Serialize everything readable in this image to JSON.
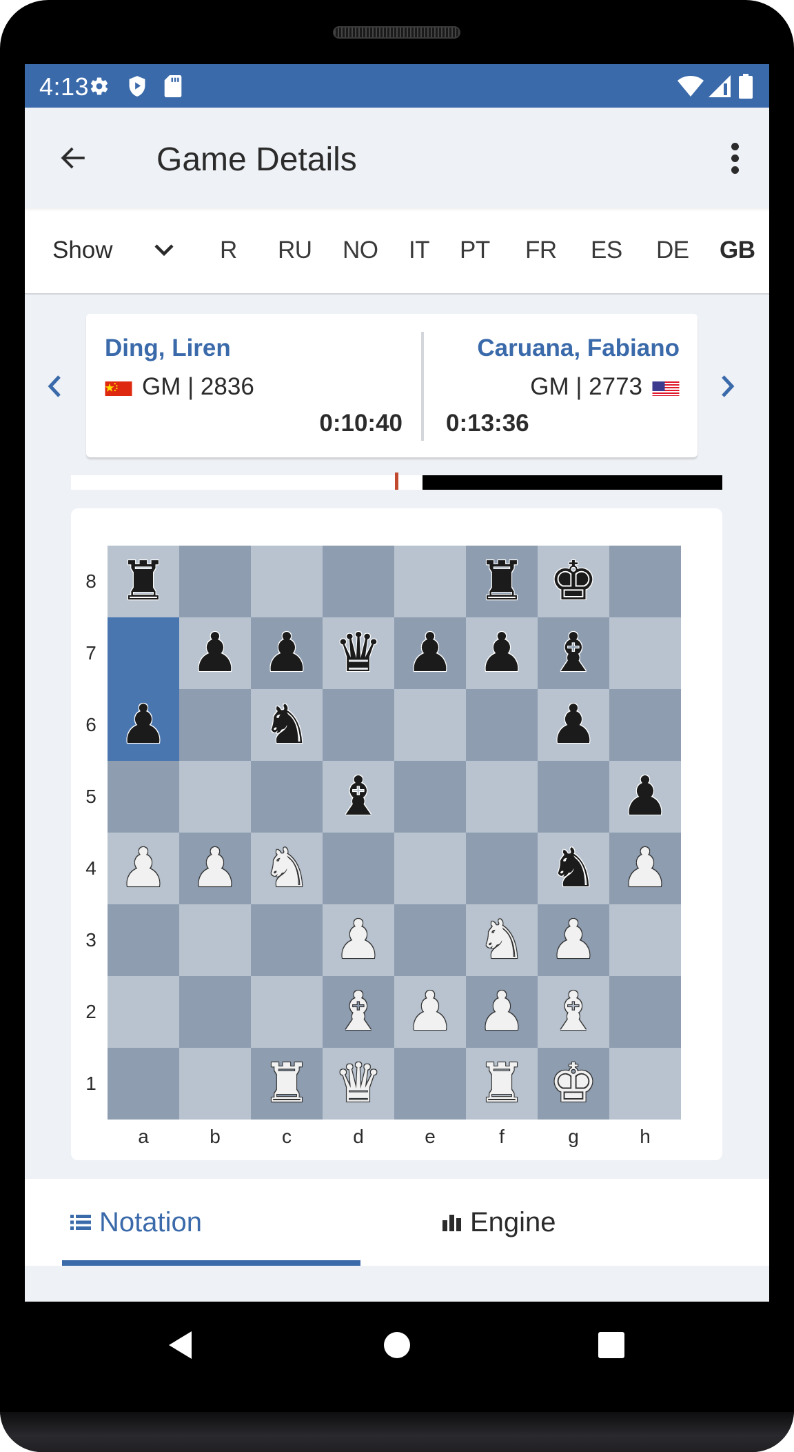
{
  "status_bar": {
    "time": "4:13",
    "left_icons": [
      "settings-icon",
      "shield-play-icon",
      "sd-card-icon"
    ],
    "right_icons": [
      "wifi-icon",
      "cell-signal-icon",
      "battery-icon"
    ]
  },
  "app_bar": {
    "title": "Game Details",
    "back_icon": "arrow-left-icon",
    "menu_icon": "more-vert-icon"
  },
  "language_row": {
    "show_label": "Show",
    "items": [
      {
        "code": "R",
        "active": false
      },
      {
        "code": "RU",
        "active": false
      },
      {
        "code": "NO",
        "active": false
      },
      {
        "code": "IT",
        "active": false
      },
      {
        "code": "PT",
        "active": false
      },
      {
        "code": "FR",
        "active": false
      },
      {
        "code": "ES",
        "active": false
      },
      {
        "code": "DE",
        "active": false
      },
      {
        "code": "GB",
        "active": true
      }
    ]
  },
  "players": {
    "white": {
      "name": "Ding, Liren",
      "title": "GM",
      "rating": "2836",
      "info": "GM | 2836",
      "country": "CN",
      "clock": "0:10:40"
    },
    "black": {
      "name": "Caruana, Fabiano",
      "title": "GM",
      "rating": "2773",
      "info": "GM | 2773",
      "country": "US",
      "clock": "0:13:36"
    }
  },
  "evaluation": {
    "white_share": 0.54
  },
  "board": {
    "orientation": "white",
    "ranks": [
      "8",
      "7",
      "6",
      "5",
      "4",
      "3",
      "2",
      "1"
    ],
    "files": [
      "a",
      "b",
      "c",
      "d",
      "e",
      "f",
      "g",
      "h"
    ],
    "position_fen": "r4rk1/1pppq1b1/p1n3p1/3b3p/PPN3nP/3P1NP1/3BPPB1/2RQ1RK1",
    "rows": [
      [
        "r",
        "",
        "",
        "",
        "",
        "r",
        "k",
        ""
      ],
      [
        "",
        "p",
        "p",
        "q",
        "p",
        "p",
        "b",
        ""
      ],
      [
        "p",
        "",
        "n",
        "",
        "",
        "",
        "p",
        ""
      ],
      [
        "",
        "",
        "",
        "b",
        "",
        "",
        "",
        "p"
      ],
      [
        "P",
        "P",
        "N",
        "",
        "",
        "",
        "n",
        "P"
      ],
      [
        "",
        "",
        "",
        "P",
        "",
        "N",
        "P",
        ""
      ],
      [
        "",
        "",
        "",
        "B",
        "P",
        "P",
        "B",
        ""
      ],
      [
        "",
        "",
        "R",
        "Q",
        "",
        "R",
        "K",
        ""
      ]
    ],
    "last_move_squares": [
      "a7",
      "a6"
    ],
    "colors": {
      "light": "#b8c3cf",
      "dark": "#8e9db0",
      "highlight": "#4a76b0"
    }
  },
  "tabs": [
    {
      "label": "Notation",
      "icon": "list-icon",
      "active": true
    },
    {
      "label": "Engine",
      "icon": "bar-chart-icon",
      "active": false
    }
  ],
  "nav_bar": {
    "buttons": [
      "back-triangle-icon",
      "home-circle-icon",
      "recents-square-icon"
    ]
  },
  "theme": {
    "accent": "#3a6aaa",
    "background": "#eef1f5",
    "text": "#2b2b2b"
  }
}
